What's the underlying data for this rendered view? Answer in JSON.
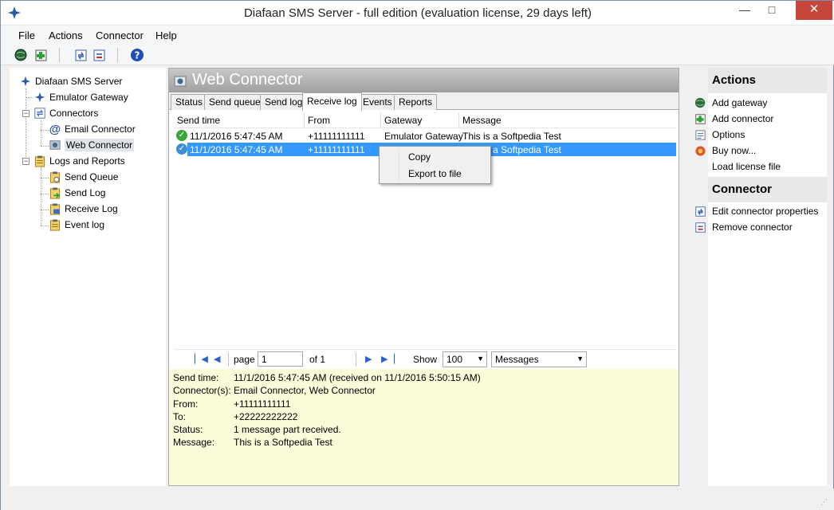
{
  "window": {
    "title": "Diafaan SMS Server - full edition (evaluation license, 29 days left)",
    "minimize": "—",
    "maximize": "□",
    "close": "✕"
  },
  "menu": [
    "File",
    "Actions",
    "Connector",
    "Help"
  ],
  "toolbar": {
    "icons": [
      "globe-add-icon",
      "add-connector-icon",
      "edit-connector-icon",
      "remove-connector-icon",
      "help-icon"
    ]
  },
  "tree": {
    "root": "Diafaan SMS Server",
    "gateway": "Emulator Gateway",
    "connectors": "Connectors",
    "email_connector": "Email Connector",
    "web_connector": "Web Connector",
    "logs": "Logs and Reports",
    "send_queue": "Send Queue",
    "send_log": "Send Log",
    "receive_log": "Receive Log",
    "event_log": "Event log"
  },
  "center": {
    "title": "Web Connector",
    "tabs": [
      "Status",
      "Send queue",
      "Send log",
      "Receive log",
      "Events",
      "Reports"
    ],
    "active_tab": "Receive log",
    "columns": [
      "Send time",
      "From",
      "Gateway",
      "Message"
    ],
    "rows": [
      {
        "send_time": "11/1/2016 5:47:45 AM",
        "from": "+11111111111",
        "gateway": "Emulator Gateway",
        "message": "This is a Softpedia Test"
      },
      {
        "send_time": "11/1/2016 5:47:45 AM",
        "from": "+11111111111",
        "gateway": "",
        "message": "This is a Softpedia Test"
      }
    ]
  },
  "pager": {
    "page_label": "page",
    "page_value": "1",
    "of_label": "of 1",
    "show_label": "Show",
    "show_value": "100",
    "type_value": "Messages"
  },
  "details": {
    "labels": [
      "Send time:",
      "Connector(s):",
      "From:",
      "To:",
      "Status:",
      "Message:"
    ],
    "values": [
      "11/1/2016 5:47:45 AM (received on 11/1/2016 5:50:15 AM)",
      "Email Connector, Web Connector",
      "+11111111111",
      "+22222222222",
      "1 message part received.",
      "This is a Softpedia Test"
    ]
  },
  "context_menu": [
    "Copy",
    "Export to file"
  ],
  "right": {
    "actions_title": "Actions",
    "actions": [
      "Add gateway",
      "Add connector",
      "Options",
      "Buy now...",
      "Load license file"
    ],
    "connector_title": "Connector",
    "connector_actions": [
      "Edit connector properties",
      "Remove connector"
    ]
  },
  "colors": {
    "selection": "#3399ff",
    "details_bg": "#fbfbda",
    "header_gradient": "#a0a0a0"
  }
}
